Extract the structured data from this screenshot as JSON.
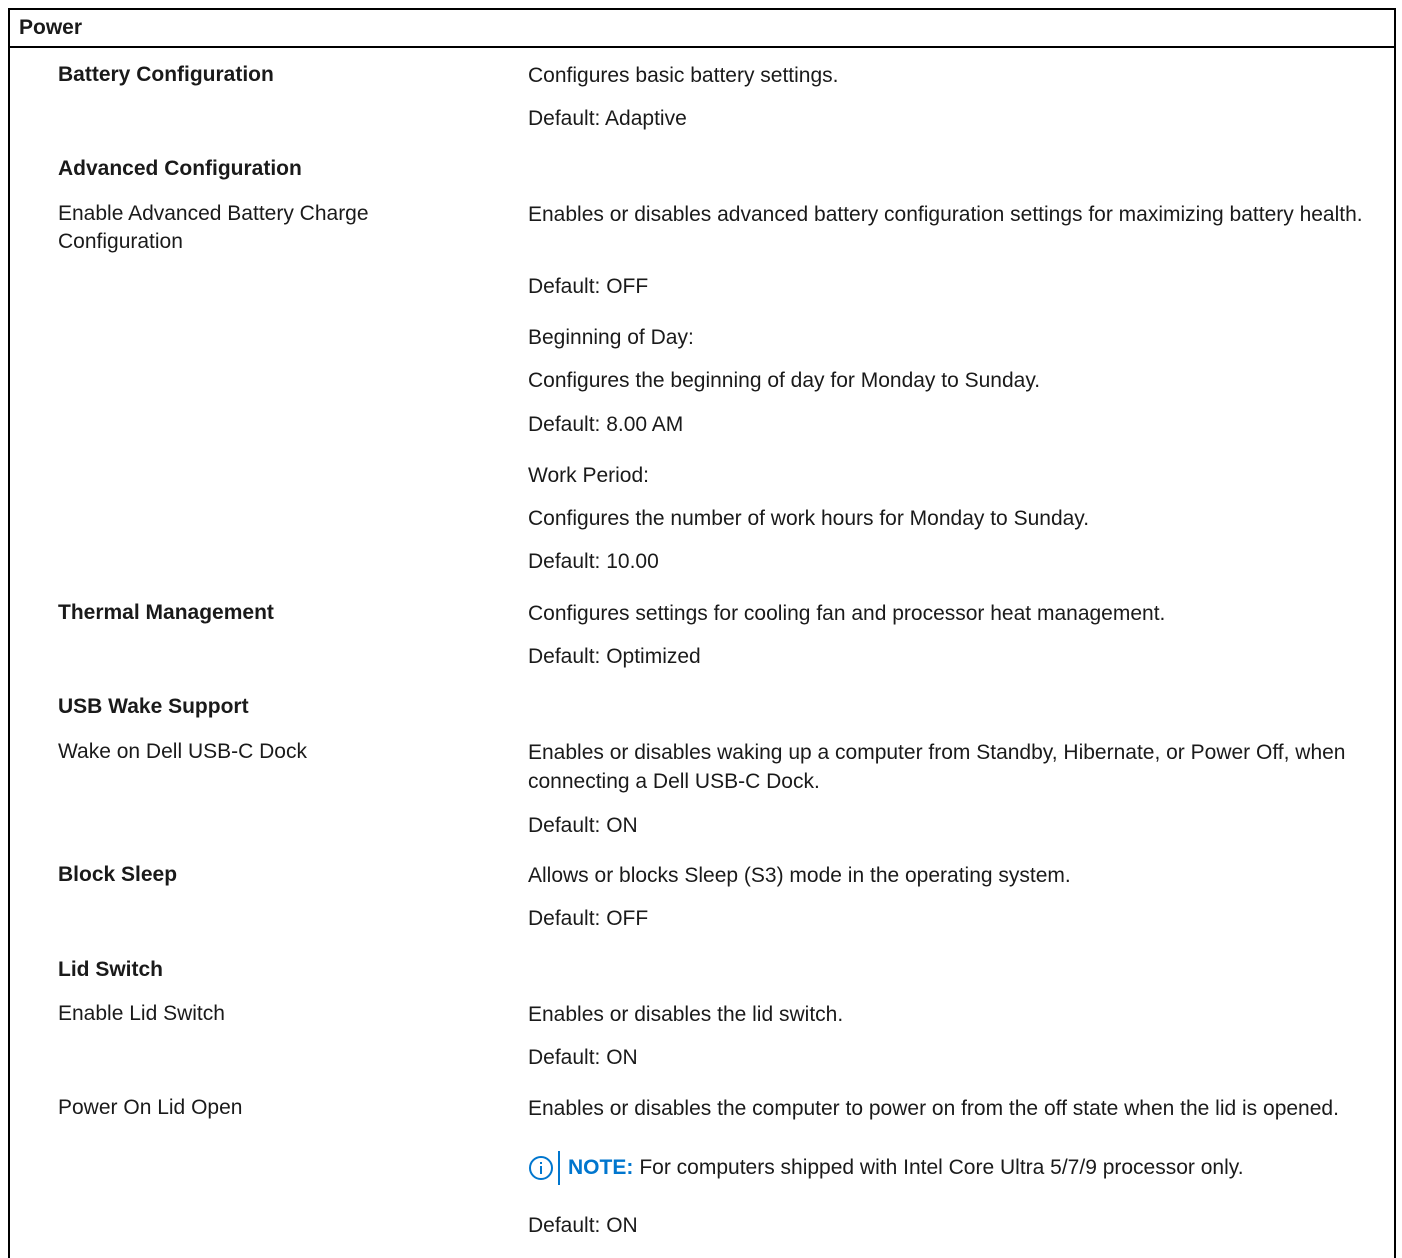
{
  "section_title": "Power",
  "rows": {
    "battery_config": {
      "label": "Battery Configuration",
      "desc": "Configures basic battery settings.",
      "default": "Default: Adaptive"
    },
    "advanced_config": {
      "label": "Advanced Configuration"
    },
    "adv_battery_charge": {
      "label": "Enable Advanced Battery Charge Configuration",
      "desc": "Enables or disables advanced battery configuration settings for maximizing battery health.",
      "default": "Default: OFF",
      "beginning_title": "Beginning of Day:",
      "beginning_desc": "Configures the beginning of day for Monday to Sunday.",
      "beginning_default": "Default: 8.00 AM",
      "work_title": "Work Period:",
      "work_desc": "Configures the number of work hours for Monday to Sunday.",
      "work_default": "Default: 10.00"
    },
    "thermal": {
      "label": "Thermal Management",
      "desc": "Configures settings for cooling fan and processor heat management.",
      "default": "Default: Optimized"
    },
    "usb_wake": {
      "label": "USB Wake Support"
    },
    "wake_dock": {
      "label": "Wake on Dell USB-C Dock",
      "desc": "Enables or disables waking up a computer from Standby, Hibernate, or Power Off, when connecting a Dell USB-C Dock.",
      "default": "Default: ON"
    },
    "block_sleep": {
      "label": "Block Sleep",
      "desc": "Allows or blocks Sleep (S3) mode in the operating system.",
      "default": "Default: OFF"
    },
    "lid_switch": {
      "label": "Lid Switch"
    },
    "enable_lid": {
      "label": "Enable Lid Switch",
      "desc": "Enables or disables the lid switch.",
      "default": "Default: ON"
    },
    "power_on_lid": {
      "label": "Power On Lid Open",
      "desc": "Enables or disables the computer to power on from the off state when the lid is opened.",
      "note_label": "NOTE:",
      "note_text": "For computers shipped with Intel Core Ultra 5/7/9 processor only.",
      "default": "Default: ON"
    }
  },
  "colors": {
    "note_accent": "#0076ce",
    "border": "#000000",
    "text": "#1a1a1a"
  },
  "icons": {
    "note": "info-circle-icon"
  }
}
